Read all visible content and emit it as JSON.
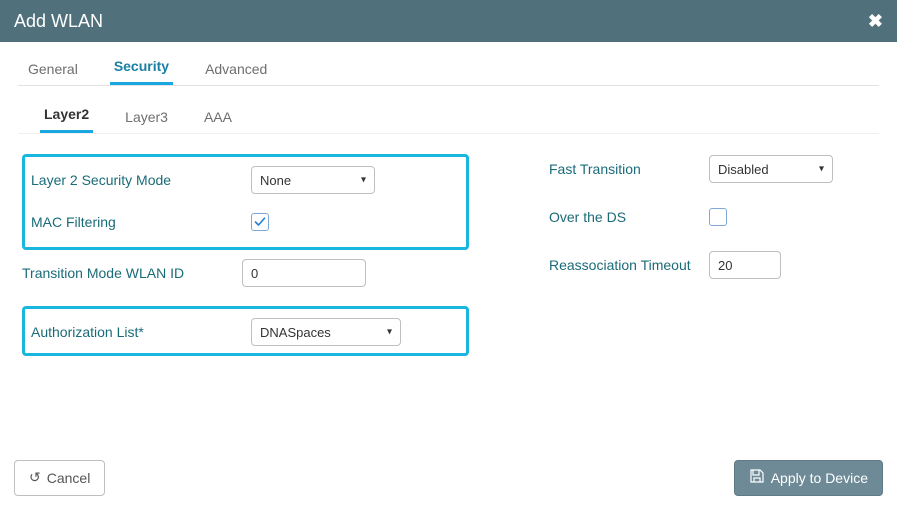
{
  "header": {
    "title": "Add WLAN"
  },
  "tabs": {
    "main": [
      "General",
      "Security",
      "Advanced"
    ],
    "main_active": 1,
    "sub": [
      "Layer2",
      "Layer3",
      "AAA"
    ],
    "sub_active": 0
  },
  "left": {
    "security_mode": {
      "label": "Layer 2 Security Mode",
      "value": "None"
    },
    "mac_filtering": {
      "label": "MAC Filtering",
      "checked": true
    },
    "transition_id": {
      "label": "Transition Mode WLAN ID",
      "value": "0"
    },
    "auth_list": {
      "label": "Authorization List*",
      "value": "DNASpaces"
    }
  },
  "right": {
    "fast_transition": {
      "label": "Fast Transition",
      "value": "Disabled"
    },
    "over_ds": {
      "label": "Over the DS",
      "checked": false
    },
    "reassoc": {
      "label": "Reassociation Timeout",
      "value": "20"
    }
  },
  "footer": {
    "cancel": "Cancel",
    "apply": "Apply to Device"
  }
}
